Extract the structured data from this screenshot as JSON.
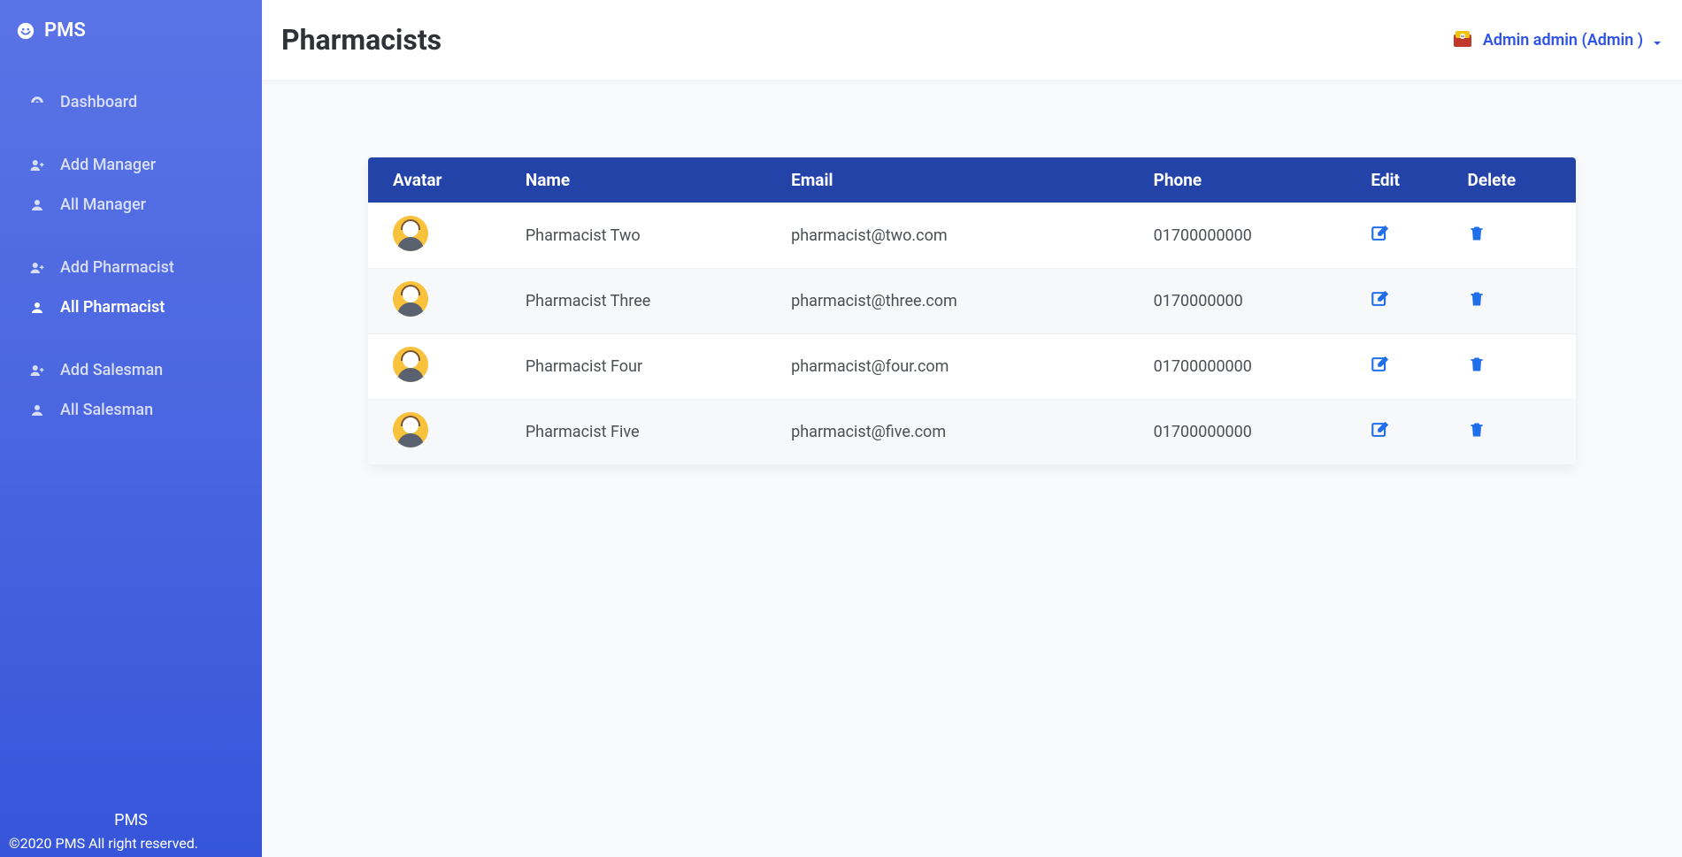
{
  "brand": {
    "name": "PMS"
  },
  "sidebar": {
    "items": [
      {
        "label": "Dashboard",
        "icon": "dashboard-icon",
        "active": false
      },
      {
        "label": "Add Manager",
        "icon": "user-plus-icon",
        "active": false
      },
      {
        "label": "All Manager",
        "icon": "user-icon",
        "active": false
      },
      {
        "label": "Add Pharmacist",
        "icon": "user-plus-icon",
        "active": false
      },
      {
        "label": "All Pharmacist",
        "icon": "user-icon",
        "active": true
      },
      {
        "label": "Add Salesman",
        "icon": "user-plus-icon",
        "active": false
      },
      {
        "label": "All Salesman",
        "icon": "user-icon",
        "active": false
      }
    ]
  },
  "footer": {
    "brand": "PMS",
    "copyright": "©2020 PMS All right reserved."
  },
  "header": {
    "title": "Pharmacists",
    "user_label": "Admin admin (Admin )"
  },
  "table": {
    "columns": [
      "Avatar",
      "Name",
      "Email",
      "Phone",
      "Edit",
      "Delete"
    ],
    "rows": [
      {
        "name": "Pharmacist Two",
        "email": "pharmacist@two.com",
        "phone": "01700000000"
      },
      {
        "name": "Pharmacist Three",
        "email": "pharmacist@three.com",
        "phone": "0170000000"
      },
      {
        "name": "Pharmacist Four",
        "email": "pharmacist@four.com",
        "phone": "01700000000"
      },
      {
        "name": "Pharmacist Five",
        "email": "pharmacist@five.com",
        "phone": "01700000000"
      }
    ]
  },
  "colors": {
    "accent": "#2f54eb",
    "table_header": "#2343a9",
    "sidebar_top": "#5a73e6",
    "sidebar_bottom": "#3655da"
  }
}
